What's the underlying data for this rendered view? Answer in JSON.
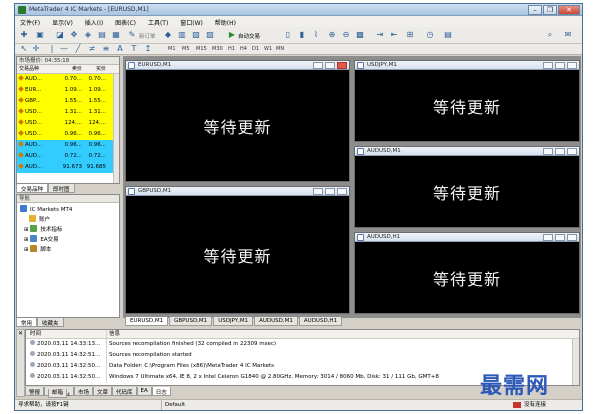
{
  "window": {
    "title": "MetaTrader 4 IC Markets - [EURUSD,M1]",
    "minimize": "–",
    "restore": "❐",
    "close": "✕"
  },
  "menu": [
    "文件(F)",
    "显示(V)",
    "插入(I)",
    "图表(C)",
    "工具(T)",
    "窗口(W)",
    "帮助(H)"
  ],
  "toolbar": {
    "new_order": "新订单",
    "auto_trading": "自动交易",
    "timeframes": [
      "M1",
      "M5",
      "M15",
      "M30",
      "H1",
      "H4",
      "D1",
      "W1",
      "MN"
    ]
  },
  "market_watch": {
    "title": "市场报价: 04:35:18",
    "columns": [
      "交易品种",
      "卖价",
      "买价"
    ],
    "rows": [
      {
        "symbol": "AUD...",
        "bid": "0.70...",
        "ask": "0.70...",
        "color": "#ffff00"
      },
      {
        "symbol": "EUR...",
        "bid": "1.09...",
        "ask": "1.09...",
        "color": "#ffff00"
      },
      {
        "symbol": "GBP...",
        "bid": "1.55...",
        "ask": "1.55...",
        "color": "#ffff00"
      },
      {
        "symbol": "USD...",
        "bid": "1.31...",
        "ask": "1.31...",
        "color": "#ffff00"
      },
      {
        "symbol": "USD...",
        "bid": "124....",
        "ask": "124....",
        "color": "#ffff00"
      },
      {
        "symbol": "USD...",
        "bid": "0.96...",
        "ask": "0.96...",
        "color": "#ffff00"
      },
      {
        "symbol": "AUD...",
        "bid": "0.96...",
        "ask": "0.96...",
        "color": "#33ccff"
      },
      {
        "symbol": "AUD...",
        "bid": "0.72...",
        "ask": "0.72...",
        "color": "#33ccff"
      },
      {
        "symbol": "AUD...",
        "bid": "91.673",
        "ask": "91.685",
        "color": "#33ccff"
      }
    ],
    "tabs": [
      "交易品种",
      "即时图"
    ]
  },
  "navigator": {
    "title": "导航",
    "root": "IC Markets MT4",
    "items": [
      "账户",
      "技术指标",
      "EA交易",
      "脚本"
    ],
    "tabs": [
      "常用",
      "收藏夹"
    ]
  },
  "charts": [
    {
      "title": "EURUSD,M1",
      "message": "等待更新"
    },
    {
      "title": "USDJPY,M1",
      "message": "等待更新"
    },
    {
      "title": "AUDUSD,M1",
      "message": "等待更新"
    },
    {
      "title": "GBPUSD,M1",
      "message": "等待更新"
    },
    {
      "title": "AUDUSD,H1",
      "message": "等待更新"
    }
  ],
  "chart_tabs": [
    "EURUSD,M1",
    "GBPUSD,M1",
    "USDJPY,M1",
    "AUDUSD,M1",
    "AUDUSD,H1"
  ],
  "terminal": {
    "columns": [
      "时间",
      "信息"
    ],
    "rows": [
      {
        "time": "2020.03.11 14:33:13...",
        "message": "Sources recompilation finished (32 compiled in 22309 msec)"
      },
      {
        "time": "2020.03.11 14:32:51...",
        "message": "Sources recompilation started"
      },
      {
        "time": "2020.03.11 14:32:50...",
        "message": "Data Folder: C:\\Program Files (x86)\\MetaTrader 4 IC Markets"
      },
      {
        "time": "2020.03.11 14:32:50...",
        "message": "Windows 7 Ultimate x64, IE 8, 2 x Intel Celeron  G1840 @ 2.80GHz, Memory: 3014 / 8060 Mb, Disk: 31 / 111 Gb, GMT+8"
      }
    ],
    "tabs": [
      "警报",
      "邮箱",
      "市场",
      "文章",
      "代码库",
      "EA",
      "日志"
    ],
    "mail_badge": "4"
  },
  "status": {
    "help": "寻求帮助，请按F1键",
    "profile": "Default",
    "connection": "没有连接"
  },
  "watermark": "最需网"
}
